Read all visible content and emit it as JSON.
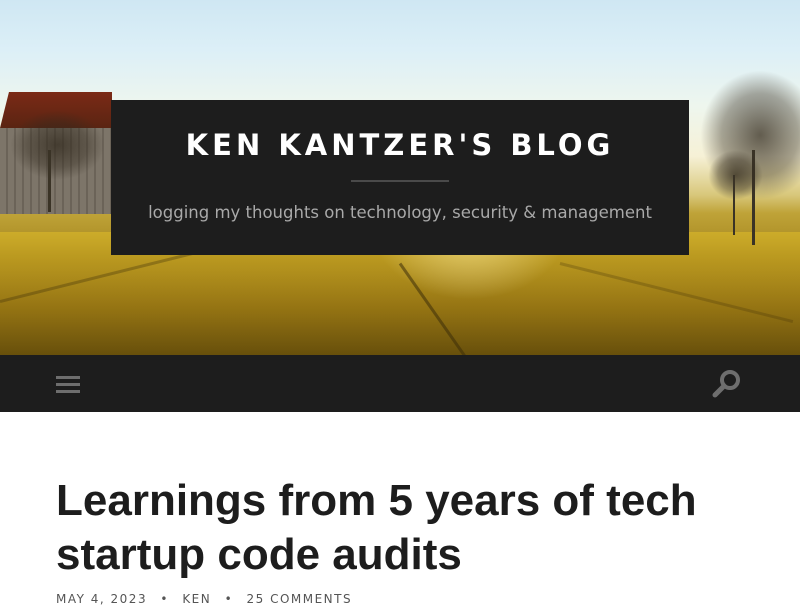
{
  "header": {
    "site_title": "KEN KANTZER'S BLOG",
    "tagline": "logging my thoughts on technology, security & management"
  },
  "navbar": {
    "menu_icon": "hamburger-menu-icon",
    "search_icon": "search-icon",
    "background": "#1d1d1d"
  },
  "post": {
    "title": "Learnings from 5 years of tech startup code audits",
    "meta": {
      "date": "MAY 4, 2023",
      "author": "KEN",
      "comments": "25 COMMENTS",
      "separator": "•"
    }
  },
  "colors": {
    "title_box": "#1d1d1d",
    "site_title": "#ffffff",
    "tagline": "#a9a9a9",
    "post_title": "#1d1d1d"
  }
}
